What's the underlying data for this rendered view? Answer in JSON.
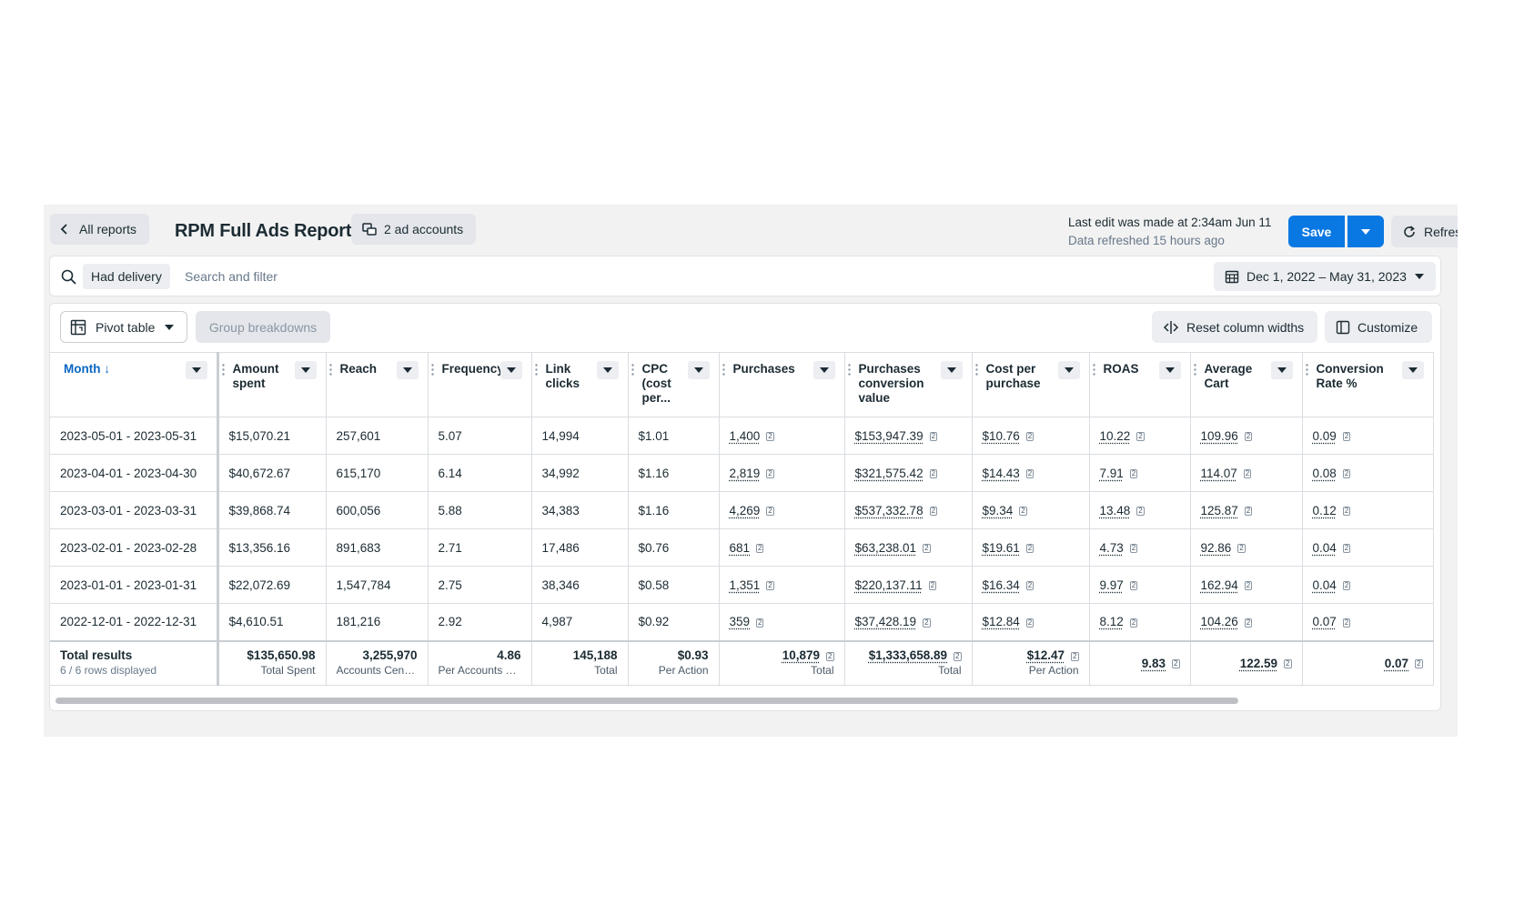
{
  "header": {
    "back_label": "All reports",
    "title": "RPM Full Ads Report",
    "accounts_label": "2 ad accounts",
    "last_edit": "Last edit was made at 2:34am Jun 11",
    "refreshed": "Data refreshed 15 hours ago",
    "save_label": "Save",
    "refresh_label": "Refresh"
  },
  "search": {
    "filter_chip": "Had delivery",
    "placeholder": "Search and filter",
    "date_range": "Dec 1, 2022 – May 31, 2023"
  },
  "toolbar": {
    "pivot_label": "Pivot table",
    "group_label": "Group breakdowns",
    "reset_label": "Reset column widths",
    "customize_label": "Customize"
  },
  "columns": [
    {
      "label": "Month ↓"
    },
    {
      "label": "Amount spent"
    },
    {
      "label": "Reach"
    },
    {
      "label": "Frequency"
    },
    {
      "label": "Link clicks"
    },
    {
      "label": "CPC (cost per..."
    },
    {
      "label": "Purchases"
    },
    {
      "label": "Purchases conversion value"
    },
    {
      "label": "Cost per purchase"
    },
    {
      "label": "ROAS"
    },
    {
      "label": "Average Cart"
    },
    {
      "label": "Conversion Rate %"
    }
  ],
  "rows": [
    [
      "2023-05-01 - 2023-05-31",
      "$15,070.21",
      "257,601",
      "5.07",
      "14,994",
      "$1.01",
      "1,400",
      "$153,947.39",
      "$10.76",
      "10.22",
      "109.96",
      "0.09"
    ],
    [
      "2023-04-01 - 2023-04-30",
      "$40,672.67",
      "615,170",
      "6.14",
      "34,992",
      "$1.16",
      "2,819",
      "$321,575.42",
      "$14.43",
      "7.91",
      "114.07",
      "0.08"
    ],
    [
      "2023-03-01 - 2023-03-31",
      "$39,868.74",
      "600,056",
      "5.88",
      "34,383",
      "$1.16",
      "4,269",
      "$537,332.78",
      "$9.34",
      "13.48",
      "125.87",
      "0.12"
    ],
    [
      "2023-02-01 - 2023-02-28",
      "$13,356.16",
      "891,683",
      "2.71",
      "17,486",
      "$0.76",
      "681",
      "$63,238.01",
      "$19.61",
      "4.73",
      "92.86",
      "0.04"
    ],
    [
      "2023-01-01 - 2023-01-31",
      "$22,072.69",
      "1,547,784",
      "2.75",
      "38,346",
      "$0.58",
      "1,351",
      "$220,137.11",
      "$16.34",
      "9.97",
      "162.94",
      "0.04"
    ],
    [
      "2022-12-01 - 2022-12-31",
      "$4,610.51",
      "181,216",
      "2.92",
      "4,987",
      "$0.92",
      "359",
      "$37,428.19",
      "$12.84",
      "8.12",
      "104.26",
      "0.07"
    ]
  ],
  "totals": {
    "label": "Total results",
    "sub": "6 / 6 rows displayed",
    "cells": [
      {
        "value": "$135,650.98",
        "sub": "Total Spent"
      },
      {
        "value": "3,255,970",
        "sub": "Accounts Cente..."
      },
      {
        "value": "4.86",
        "sub": "Per Accounts Ce..."
      },
      {
        "value": "145,188",
        "sub": "Total"
      },
      {
        "value": "$0.93",
        "sub": "Per Action"
      },
      {
        "value": "10,879",
        "sub": "Total"
      },
      {
        "value": "$1,333,658.89",
        "sub": "Total"
      },
      {
        "value": "$12.47",
        "sub": "Per Action"
      },
      {
        "value": "9.83",
        "sub": ""
      },
      {
        "value": "122.59",
        "sub": ""
      },
      {
        "value": "0.07",
        "sub": ""
      }
    ]
  },
  "tag_label": "2",
  "colors": {
    "accent": "#0a78e3",
    "link": "#0a66c2"
  }
}
